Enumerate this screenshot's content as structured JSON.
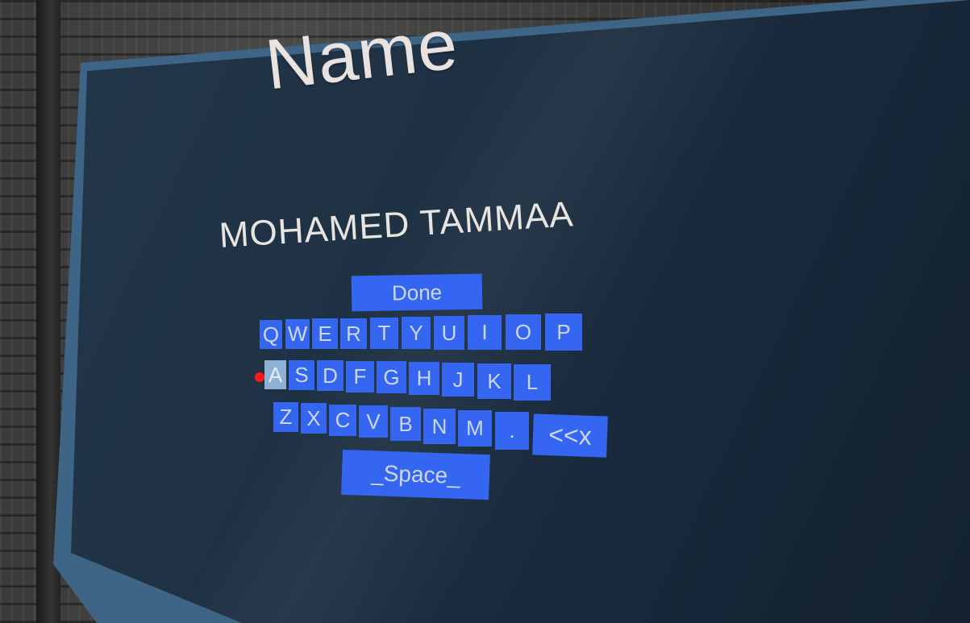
{
  "screen": {
    "title": "Name",
    "entered_name": "MOHAMED TAMMAA"
  },
  "keyboard": {
    "done_label": "Done",
    "row1": [
      "Q",
      "W",
      "E",
      "R",
      "T",
      "Y",
      "U",
      "I",
      "O",
      "P"
    ],
    "row2": [
      "A",
      "S",
      "D",
      "F",
      "G",
      "H",
      "J",
      "K",
      "L"
    ],
    "row3": [
      "Z",
      "X",
      "C",
      "V",
      "B",
      "N",
      "M",
      "."
    ],
    "backspace_label": "<<x",
    "space_label": "_Space_",
    "hovered_key": "A",
    "key_color": "#3466f2",
    "hover_color": "#8eb2d6"
  }
}
